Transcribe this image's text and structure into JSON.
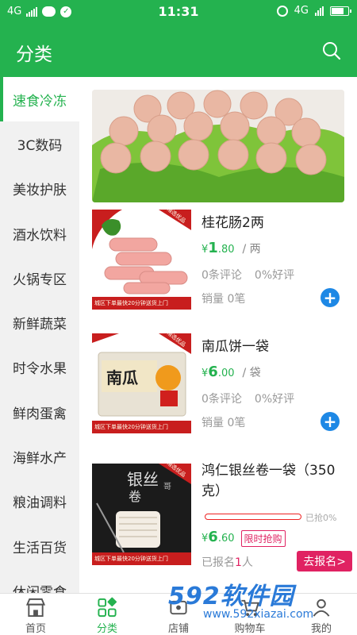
{
  "status": {
    "network_left": "4G",
    "time": "11:31",
    "network_right": "4G"
  },
  "header": {
    "title": "分类"
  },
  "sidebar": {
    "items": [
      {
        "label": "速食冷冻"
      },
      {
        "label": "3C数码"
      },
      {
        "label": "美妆护肤"
      },
      {
        "label": "酒水饮料"
      },
      {
        "label": "火锅专区"
      },
      {
        "label": "新鲜蔬菜"
      },
      {
        "label": "时令水果"
      },
      {
        "label": "鲜肉蛋禽"
      },
      {
        "label": "海鲜水产"
      },
      {
        "label": "粮油调料"
      },
      {
        "label": "生活百货"
      },
      {
        "label": "休闲零食"
      }
    ]
  },
  "products": [
    {
      "name": "桂花肠2两",
      "price_symbol": "¥",
      "price_int": "1",
      "price_dec": ".80",
      "unit": "/ 两",
      "reviews": "0条评论",
      "good_rate": "0%好评",
      "sales": "销量 0笔",
      "img_banner_text": "城区下单最快20分钟送货上门",
      "img_tag": "精选优品"
    },
    {
      "name": "南瓜饼一袋",
      "price_symbol": "¥",
      "price_int": "6",
      "price_dec": ".00",
      "unit": "/ 袋",
      "reviews": "0条评论",
      "good_rate": "0%好评",
      "sales": "销量 0笔",
      "img_banner_text": "城区下单最快20分钟送货上门",
      "img_tag": "精选优品",
      "img_pack_text": "南瓜"
    },
    {
      "name": "鸿仁银丝卷一袋（350克）",
      "price_symbol": "¥",
      "price_int": "6",
      "price_dec": ".60",
      "progress": 0,
      "progress_text": "已抢0%",
      "flash_label": "限时抢购",
      "signup_prefix": "已报名",
      "signup_count": "1",
      "signup_suffix": "人",
      "signup_button": "去报名>",
      "img_banner_text": "城区下单最快20分钟送货上门",
      "img_tag": "精选优品",
      "img_text_1": "银丝",
      "img_text_2": "卷",
      "img_text_3": "哥"
    }
  ],
  "tabbar": {
    "items": [
      {
        "label": "首页",
        "icon": "store-icon"
      },
      {
        "label": "分类",
        "icon": "category-icon"
      },
      {
        "label": "店铺",
        "icon": "shop-icon"
      },
      {
        "label": "购物车",
        "icon": "cart-icon"
      },
      {
        "label": "我的",
        "icon": "user-icon"
      }
    ]
  },
  "watermark": {
    "big": "592软件园",
    "small": "www.592xiazai.com"
  },
  "colors": {
    "primary": "#24b24f",
    "price": "#24b24f",
    "add_button": "#1e88e5",
    "flash": "#e02262"
  }
}
